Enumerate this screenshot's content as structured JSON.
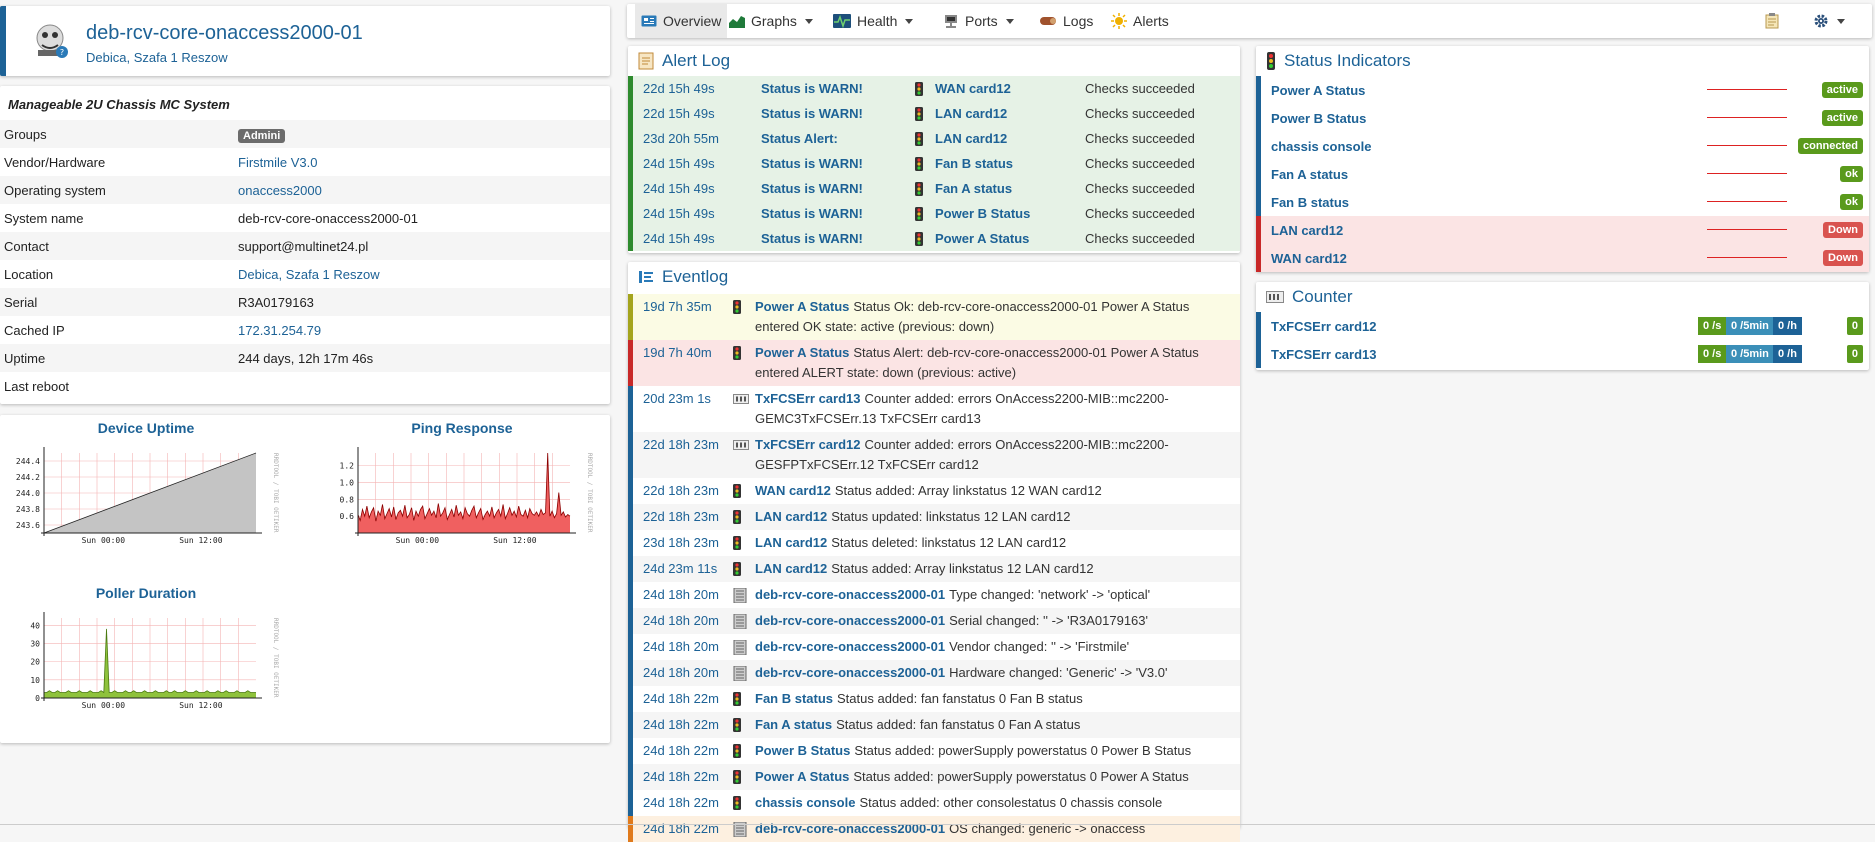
{
  "device": {
    "title": "deb-rcv-core-onaccess2000-01",
    "location": "Debica, Szafa 1 Reszow"
  },
  "overview": {
    "heading": "Manageable 2U Chassis MC System",
    "rows": [
      {
        "key": "Groups",
        "value": "Admini"
      },
      {
        "key": "Vendor/Hardware",
        "value": "Firstmile V3.0"
      },
      {
        "key": "Operating system",
        "value": "onaccess2000"
      },
      {
        "key": "System name",
        "value": "deb-rcv-core-onaccess2000-01"
      },
      {
        "key": "Contact",
        "value": "support@multinet24.pl"
      },
      {
        "key": "Location",
        "value": "Debica, Szafa 1 Reszow"
      },
      {
        "key": "Serial",
        "value": "R3A0179163"
      },
      {
        "key": "Cached IP",
        "value": "172.31.254.79"
      },
      {
        "key": "Uptime",
        "value": "244 days, 12h 17m 46s"
      },
      {
        "key": "Last reboot",
        "value": ""
      }
    ]
  },
  "graphs": {
    "uptime": {
      "title": "Device Uptime",
      "y_ticks": [
        "244.4",
        "244.2",
        "244.0",
        "243.8",
        "243.6"
      ],
      "x_ticks": [
        "Sun 00:00",
        "Sun 12:00"
      ],
      "side_label": "RRDTOOL / TOBI OETIKER",
      "y_range": [
        243.5,
        244.5
      ],
      "series": [
        243.5,
        244.5
      ]
    },
    "ping": {
      "title": "Ping Response",
      "y_ticks": [
        "1.2",
        "1.0",
        "0.8",
        "0.6"
      ],
      "x_ticks": [
        "Sun 00:00",
        "Sun 12:00"
      ],
      "side_label": "RRDTOOL / TOBI OETIKER",
      "y_range": [
        0.4,
        1.35
      ],
      "series": [
        0.62,
        0.55,
        0.68,
        0.6,
        0.72,
        0.58,
        0.65,
        0.7,
        0.54,
        0.66,
        0.61,
        0.74,
        0.57,
        0.63,
        0.69,
        0.59,
        0.71,
        0.56,
        0.64,
        0.67,
        0.6,
        0.73,
        0.58,
        0.62,
        0.7,
        0.55,
        0.66,
        0.6,
        0.68,
        0.72,
        0.57,
        0.63,
        0.69,
        0.61,
        0.66,
        0.58,
        0.75,
        0.6,
        0.64,
        0.7,
        0.56,
        0.62,
        0.68,
        0.59,
        0.73,
        0.61,
        0.65,
        0.57,
        0.7,
        0.63,
        0.6,
        0.67,
        0.72,
        0.58,
        0.64,
        0.69,
        0.56,
        0.62,
        0.66,
        0.6,
        0.71,
        0.58,
        0.64,
        0.68,
        0.6,
        0.74,
        0.57,
        0.63,
        0.7,
        0.61,
        0.66,
        0.59,
        0.72,
        0.62,
        0.6,
        0.67,
        0.58,
        0.69,
        0.63,
        0.61,
        0.65,
        0.6,
        0.68,
        0.62,
        0.64,
        1.35,
        0.6,
        0.66,
        0.58,
        0.63,
        0.88,
        0.61,
        0.65,
        0.59,
        0.62,
        0.6
      ],
      "fill_color": "#f06060"
    },
    "poller": {
      "title": "Poller Duration",
      "y_ticks": [
        "40",
        "30",
        "20",
        "10",
        "0"
      ],
      "x_ticks": [
        "Sun 00:00",
        "Sun 12:00"
      ],
      "side_label": "RRDTOOL / TOBI OETIKER",
      "y_range": [
        0,
        44
      ],
      "series": [
        3,
        3,
        4,
        3,
        3,
        4,
        3,
        3,
        3,
        4,
        3,
        3,
        3,
        4,
        3,
        3,
        3,
        4,
        3,
        3,
        3,
        4,
        3,
        38,
        3,
        3,
        4,
        3,
        3,
        3,
        4,
        3,
        3,
        4,
        3,
        3,
        3,
        4,
        3,
        3,
        3,
        4,
        3,
        3,
        3,
        4,
        3,
        3,
        4,
        3,
        3,
        3,
        4,
        3,
        3,
        3,
        4,
        3,
        3,
        3,
        4,
        3,
        3,
        3,
        4,
        3,
        3,
        4,
        3,
        3,
        3,
        4,
        3,
        3,
        3,
        4,
        3,
        3,
        3
      ],
      "fill_color": "#8fc23c"
    }
  },
  "nav": {
    "items": [
      {
        "label": "Overview",
        "icon": "overview-icon"
      },
      {
        "label": "Graphs",
        "icon": "graphs-icon"
      },
      {
        "label": "Health",
        "icon": "health-icon"
      },
      {
        "label": "Ports",
        "icon": "ports-icon"
      },
      {
        "label": "Logs",
        "icon": "logs-icon"
      },
      {
        "label": "Alerts",
        "icon": "alerts-icon"
      }
    ]
  },
  "alertlog": {
    "title": "Alert Log",
    "rows": [
      {
        "time": "22d 15h 49s",
        "status": "Status is WARN!",
        "entity": "WAN card12",
        "result": "Checks succeeded"
      },
      {
        "time": "22d 15h 49s",
        "status": "Status is WARN!",
        "entity": "LAN card12",
        "result": "Checks succeeded"
      },
      {
        "time": "23d 20h 55m",
        "status": "Status Alert:",
        "entity": "LAN card12",
        "result": "Checks succeeded"
      },
      {
        "time": "24d 15h 49s",
        "status": "Status is WARN!",
        "entity": "Fan B status",
        "result": "Checks succeeded"
      },
      {
        "time": "24d 15h 49s",
        "status": "Status is WARN!",
        "entity": "Fan A status",
        "result": "Checks succeeded"
      },
      {
        "time": "24d 15h 49s",
        "status": "Status is WARN!",
        "entity": "Power B Status",
        "result": "Checks succeeded"
      },
      {
        "time": "24d 15h 49s",
        "status": "Status is WARN!",
        "entity": "Power A Status",
        "result": "Checks succeeded"
      }
    ]
  },
  "eventlog": {
    "title": "Eventlog",
    "rows": [
      {
        "time": "19d 7h 35m",
        "icon": "status",
        "entity": "Power A Status",
        "text": "Status Ok: deb-rcv-core-onaccess2000-01 Power A Status entered OK state: active (previous: down)",
        "kind": "ok"
      },
      {
        "time": "19d 7h 40m",
        "icon": "status",
        "entity": "Power A Status",
        "text": "Status Alert: deb-rcv-core-onaccess2000-01 Power A Status entered ALERT state: down (previous: active)",
        "kind": "alert"
      },
      {
        "time": "20d 23m 1s",
        "icon": "counter",
        "entity": "TxFCSErr card13",
        "text": "Counter added: errors OnAccess2200-MIB::mc2200-GEMC3TxFCSErr.13 TxFCSErr card13",
        "kind": ""
      },
      {
        "time": "22d 18h 23m",
        "icon": "counter",
        "entity": "TxFCSErr card12",
        "text": "Counter added: errors OnAccess2200-MIB::mc2200-GESFPTxFCSErr.12 TxFCSErr card12",
        "kind": ""
      },
      {
        "time": "22d 18h 23m",
        "icon": "status",
        "entity": "WAN card12",
        "text": "Status added: Array linkstatus 12 WAN card12",
        "kind": ""
      },
      {
        "time": "22d 18h 23m",
        "icon": "status",
        "entity": "LAN card12",
        "text": "Status updated: linkstatus 12 LAN card12",
        "kind": ""
      },
      {
        "time": "23d 18h 23m",
        "icon": "status",
        "entity": "LAN card12",
        "text": "Status deleted: linkstatus 12 LAN card12",
        "kind": ""
      },
      {
        "time": "24d 23m 11s",
        "icon": "status",
        "entity": "LAN card12",
        "text": "Status added: Array linkstatus 12 LAN card12",
        "kind": ""
      },
      {
        "time": "24d 18h 20m",
        "icon": "device",
        "entity": "deb-rcv-core-onaccess2000-01",
        "text": "Type changed: 'network' -> 'optical'",
        "kind": ""
      },
      {
        "time": "24d 18h 20m",
        "icon": "device",
        "entity": "deb-rcv-core-onaccess2000-01",
        "text": "Serial changed: '' -> 'R3A0179163'",
        "kind": ""
      },
      {
        "time": "24d 18h 20m",
        "icon": "device",
        "entity": "deb-rcv-core-onaccess2000-01",
        "text": "Vendor changed: '' -> 'Firstmile'",
        "kind": ""
      },
      {
        "time": "24d 18h 20m",
        "icon": "device",
        "entity": "deb-rcv-core-onaccess2000-01",
        "text": "Hardware changed: 'Generic' -> 'V3.0'",
        "kind": ""
      },
      {
        "time": "24d 18h 22m",
        "icon": "status",
        "entity": "Fan B status",
        "text": "Status added: fan fanstatus 0 Fan B status",
        "kind": ""
      },
      {
        "time": "24d 18h 22m",
        "icon": "status",
        "entity": "Fan A status",
        "text": "Status added: fan fanstatus 0 Fan A status",
        "kind": ""
      },
      {
        "time": "24d 18h 22m",
        "icon": "status",
        "entity": "Power B Status",
        "text": "Status added: powerSupply powerstatus 0 Power B Status",
        "kind": ""
      },
      {
        "time": "24d 18h 22m",
        "icon": "status",
        "entity": "Power A Status",
        "text": "Status added: powerSupply powerstatus 0 Power A Status",
        "kind": ""
      },
      {
        "time": "24d 18h 22m",
        "icon": "status",
        "entity": "chassis console",
        "text": "Status added: other consolestatus 0 chassis console",
        "kind": ""
      },
      {
        "time": "24d 18h 22m",
        "icon": "device",
        "entity": "deb-rcv-core-onaccess2000-01",
        "text": "OS changed: generic -> onaccess",
        "kind": "warn"
      }
    ]
  },
  "status": {
    "title": "Status Indicators",
    "rows": [
      {
        "name": "Power A Status",
        "state": "active",
        "color": "#5a9a1c",
        "down": false
      },
      {
        "name": "Power B Status",
        "state": "active",
        "color": "#5a9a1c",
        "down": false
      },
      {
        "name": "chassis console",
        "state": "connected",
        "color": "#5a9a1c",
        "down": false
      },
      {
        "name": "Fan A status",
        "state": "ok",
        "color": "#5a9a1c",
        "down": false
      },
      {
        "name": "Fan B status",
        "state": "ok",
        "color": "#5a9a1c",
        "down": false
      },
      {
        "name": "LAN card12",
        "state": "Down",
        "color": "#d9534f",
        "down": true
      },
      {
        "name": "WAN card12",
        "state": "Down",
        "color": "#d9534f",
        "down": true
      }
    ]
  },
  "counter": {
    "title": "Counter",
    "rows": [
      {
        "name": "TxFCSErr card12",
        "rate_s": "0 /s",
        "rate_5m": "0 /5min",
        "rate_h": "0 /h",
        "value": "0"
      },
      {
        "name": "TxFCSErr card13",
        "rate_s": "0 /s",
        "rate_5m": "0 /5min",
        "rate_h": "0 /h",
        "value": "0"
      }
    ]
  },
  "colors": {
    "accent": "#1d6296",
    "ok_green": "#5a9a1c",
    "down_red": "#d9534f",
    "rate_blue": "#3b8fb8",
    "rate_dark": "#1d6296"
  }
}
